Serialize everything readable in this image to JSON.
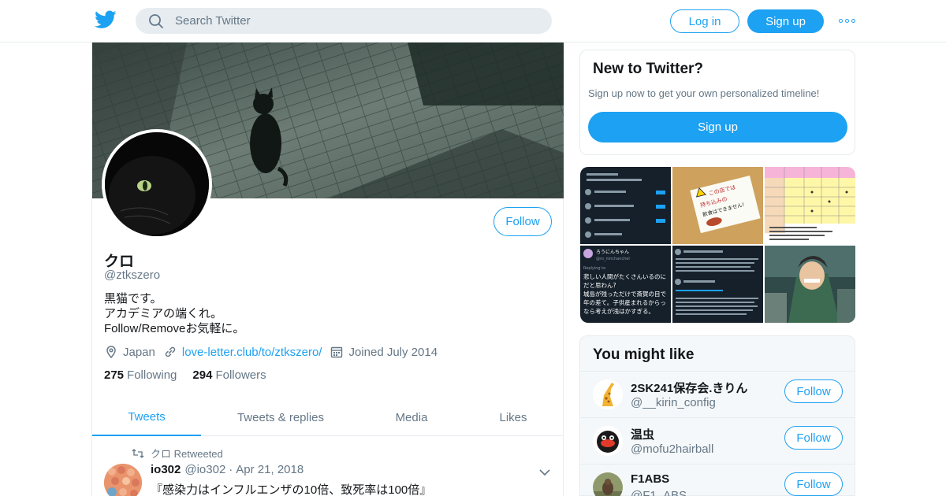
{
  "header": {
    "logo_icon": "twitter-bird-icon",
    "search_placeholder": "Search Twitter",
    "login_label": "Log in",
    "signup_label": "Sign up",
    "more_icon": "more-dots-icon"
  },
  "colors": {
    "accent": "#1da1f2",
    "muted": "#657786",
    "text": "#14171a",
    "border": "#e6ecf0"
  },
  "profile": {
    "follow_label": "Follow",
    "name": "クロ",
    "handle": "@ztkszero",
    "bio": [
      "黒猫です。",
      "アカデミアの端くれ。",
      "Follow/Removeお気軽に。"
    ],
    "location": "Japan",
    "website": "love-letter.club/to/ztkszero/",
    "joined": "Joined July 2014",
    "following_count": "275",
    "following_label": "Following",
    "followers_count": "294",
    "followers_label": "Followers"
  },
  "tabs": [
    {
      "label": "Tweets",
      "active": true
    },
    {
      "label": "Tweets & replies",
      "active": false
    },
    {
      "label": "Media",
      "active": false
    },
    {
      "label": "Likes",
      "active": false
    }
  ],
  "tweet": {
    "retweeted_by": "クロ Retweeted",
    "author_name": "io302",
    "author_handle": "@io302",
    "separator": "·",
    "date": "Apr 21, 2018",
    "text": "『感染力はインフルエンザの10倍、致死率は100倍』"
  },
  "sidebar": {
    "new_title": "New to Twitter?",
    "new_text": "Sign up now to get your own personalized timeline!",
    "new_signup": "Sign up",
    "media_images": [
      "dark-mode-tweet-thread-screenshot",
      "food-warning-sign-photo",
      "colored-table-screenshot",
      "japanese-tweet-screenshot",
      "dark-tweet-with-image-screenshot",
      "anime-soldier-screenshot"
    ],
    "media_text": {
      "sign": [
        "この店では",
        "持ち込みの",
        "飲食はできません!"
      ],
      "tweet_name": "ろうにんちゃん",
      "tweet_handle": "@ro_ninchanchel",
      "tweet_reply": "Replying to",
      "tweet_body": [
        "悲しい人間がたくさんいるのに",
        "だと思わん?",
        "城島が残っただけで斎賀の目で",
        "年の差て。子供産まれるからっ",
        "なら考えが浅はかすぎる。"
      ]
    },
    "like_title": "You might like",
    "like_follow": "Follow",
    "suggestions": [
      {
        "name": "2SK241保存会.きりん",
        "handle": "@__kirin_config",
        "avatar": "giraffe-avatar"
      },
      {
        "name": "温虫",
        "handle": "@mofu2hairball",
        "avatar": "fluffy-bug-avatar"
      },
      {
        "name": "F1ABS",
        "handle": "@F1_ABS",
        "avatar": "bird-photo-avatar"
      }
    ]
  }
}
